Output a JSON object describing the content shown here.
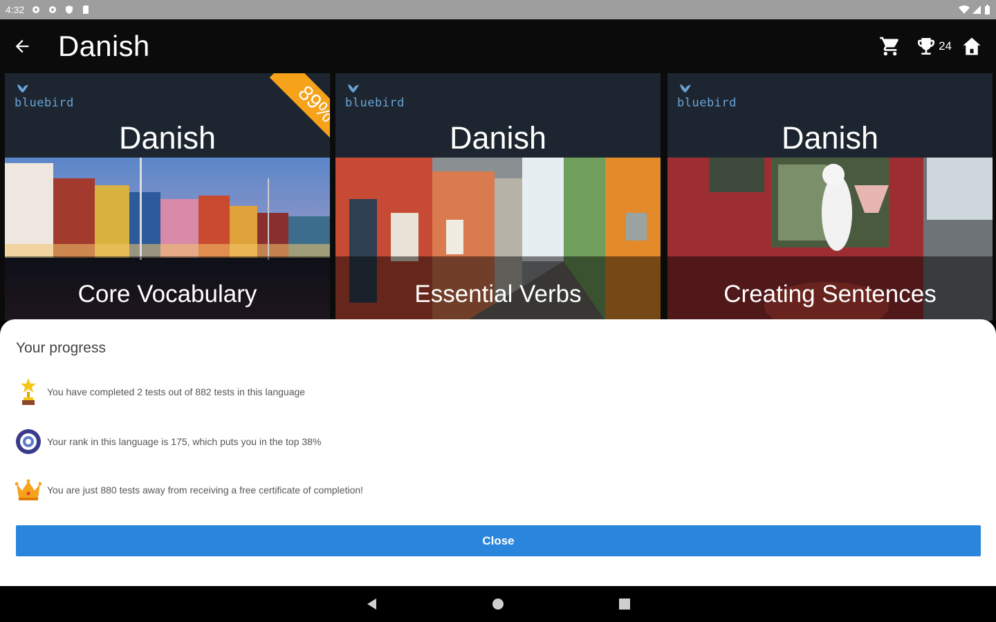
{
  "status_bar": {
    "time": "4:32"
  },
  "app_bar": {
    "title": "Danish",
    "trophy_count": "24"
  },
  "cards": [
    {
      "brand": "bluebird",
      "language": "Danish",
      "name": "Core Vocabulary",
      "badge": "89%"
    },
    {
      "brand": "bluebird",
      "language": "Danish",
      "name": "Essential Verbs"
    },
    {
      "brand": "bluebird",
      "language": "Danish",
      "name": "Creating Sentences"
    }
  ],
  "progress": {
    "title": "Your progress",
    "rows": [
      {
        "icon": "trophy-icon",
        "text": "You have completed 2 tests out of 882 tests in this language"
      },
      {
        "icon": "rank-medal-icon",
        "text": "Your rank in this language is 175, which puts you in the top 38%"
      },
      {
        "icon": "crown-icon",
        "text": "You are just 880 tests away from receiving a free certificate of completion!"
      }
    ],
    "close_label": "Close"
  },
  "colors": {
    "accent": "#2a86dc",
    "ribbon": "#f7a21b",
    "card_header": "#1d2630"
  }
}
